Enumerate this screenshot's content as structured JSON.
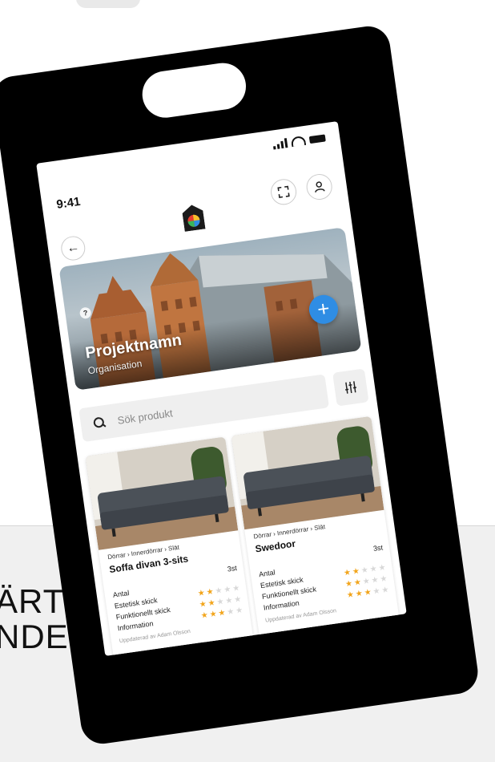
{
  "tagline": {
    "line1": "ÄRT",
    "line2": "NDE"
  },
  "status": {
    "time": "9:41"
  },
  "project": {
    "name": "Projektnamn",
    "organisation": "Organisation",
    "help_badge": "?",
    "add_label": "+"
  },
  "search": {
    "placeholder": "Sök produkt"
  },
  "labels": {
    "quantity": "Antal",
    "aesthetic": "Estetisk skick",
    "functional": "Funktionellt skick",
    "information": "Information"
  },
  "products": [
    {
      "breadcrumb": "Dörrar › Innerdörrar › Slät",
      "name": "Soffa divan 3-sits",
      "quantity": "3st",
      "aesthetic_rating": 2,
      "functional_rating": 2,
      "information_rating": 3,
      "updated": "Uppdaterad av Adam Olsson"
    },
    {
      "breadcrumb": "Dörrar › Innerdörrar › Slät",
      "name": "Swedoor",
      "quantity": "3st",
      "aesthetic_rating": 2,
      "functional_rating": 2,
      "information_rating": 3,
      "updated": "Uppdaterad av Adam Olsson"
    }
  ],
  "rating_max": 5,
  "icons": {
    "back": "arrow-left-icon",
    "expand": "expand-icon",
    "user": "user-icon",
    "search": "search-icon",
    "filter": "filter-sliders-icon",
    "logo": "house-logo-icon"
  },
  "colors": {
    "accent": "#2f8de4",
    "star": "#f2a51c",
    "tag": "#000000"
  }
}
